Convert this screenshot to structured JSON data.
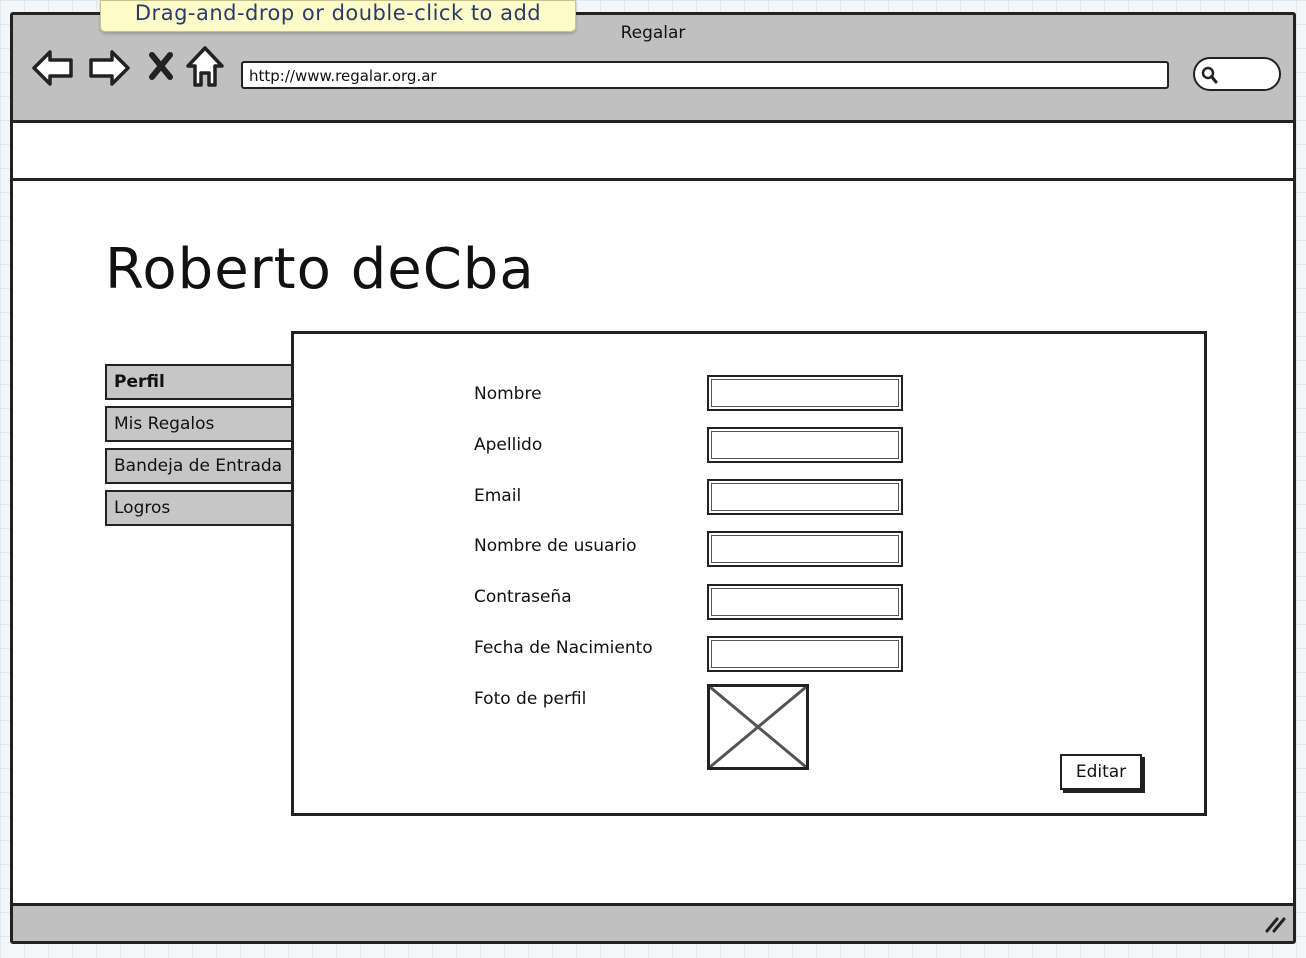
{
  "tooltip": {
    "text": "Drag-and-drop or double-click to add"
  },
  "browser": {
    "title": "Regalar",
    "url": "http://www.regalar.org.ar",
    "icons": [
      "back-arrow-icon",
      "forward-arrow-icon",
      "close-x-icon",
      "home-icon",
      "search-icon",
      "resize-grip-icon"
    ]
  },
  "page": {
    "heading": "Roberto deCba"
  },
  "tabs": [
    {
      "label": "Perfil",
      "active": true
    },
    {
      "label": "Mis Regalos",
      "active": false
    },
    {
      "label": "Bandeja de Entrada",
      "active": false
    },
    {
      "label": "Logros",
      "active": false
    }
  ],
  "form": {
    "fields": [
      {
        "label": "Nombre",
        "value": ""
      },
      {
        "label": "Apellido",
        "value": ""
      },
      {
        "label": "Email",
        "value": ""
      },
      {
        "label": "Nombre de usuario",
        "value": ""
      },
      {
        "label": "Contraseña",
        "value": ""
      },
      {
        "label": "Fecha de Nacimiento",
        "value": ""
      }
    ],
    "photo_label": "Foto de perfil",
    "edit_button": "Editar"
  },
  "colors": {
    "chrome": "#c0c0c0",
    "tab": "#c6c6c6",
    "tooltip": "#fdfbc8",
    "tooltip_text": "#2a3b6a"
  }
}
